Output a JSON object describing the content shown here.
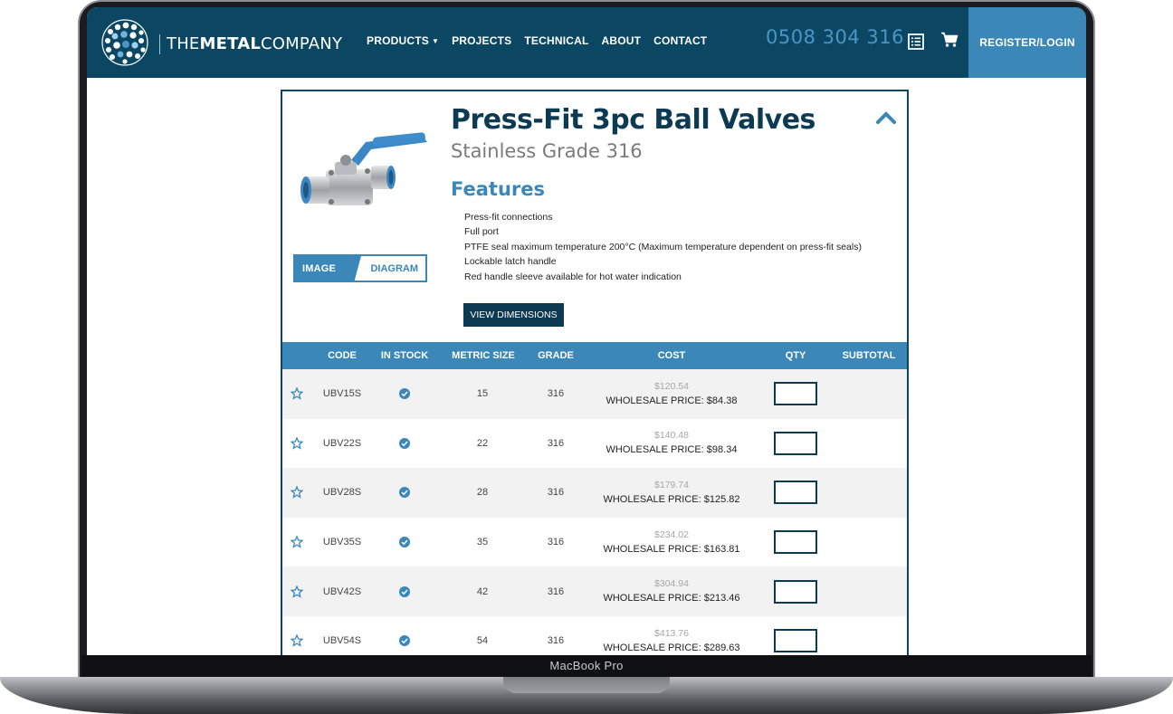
{
  "device_label": "MacBook Pro",
  "header": {
    "logo_text_light_1": "THE",
    "logo_text_bold": "METAL",
    "logo_text_light_2": "COMPANY",
    "nav": [
      {
        "label": "PRODUCTS",
        "has_dropdown": true
      },
      {
        "label": "PROJECTS"
      },
      {
        "label": "TECHNICAL"
      },
      {
        "label": "ABOUT"
      },
      {
        "label": "CONTACT"
      }
    ],
    "phone": "0508 304 316",
    "register_label": "REGISTER/LOGIN",
    "list_icon": "list-icon",
    "cart_icon": "cart-icon"
  },
  "product": {
    "title": "Press-Fit 3pc Ball Valves",
    "subtitle": "Stainless Grade 316",
    "toggle": {
      "image_label": "IMAGE",
      "diagram_label": "DIAGRAM",
      "selected": "IMAGE"
    },
    "features_heading": "Features",
    "features": [
      "Press-fit connections",
      "Full port",
      "PTFE seal maximum temperature 200°C (Maximum temperature dependent on press-fit seals)",
      "Lockable latch handle",
      "Red handle sleeve available for hot water indication"
    ],
    "view_dimensions_label": "VIEW DIMENSIONS"
  },
  "table": {
    "headers": {
      "code": "CODE",
      "in_stock": "IN STOCK",
      "metric_size": "METRIC SIZE",
      "grade": "GRADE",
      "cost": "COST",
      "qty": "QTY",
      "subtotal": "SUBTOTAL"
    },
    "rows": [
      {
        "code": "UBV15S",
        "in_stock": true,
        "size": "15",
        "grade": "316",
        "rrp": "$120.54",
        "wholesale_label": "WHOLESALE PRICE: ",
        "wholesale": "$84.38"
      },
      {
        "code": "UBV22S",
        "in_stock": true,
        "size": "22",
        "grade": "316",
        "rrp": "$140.48",
        "wholesale_label": "WHOLESALE PRICE: ",
        "wholesale": "$98.34"
      },
      {
        "code": "UBV28S",
        "in_stock": true,
        "size": "28",
        "grade": "316",
        "rrp": "$179.74",
        "wholesale_label": "WHOLESALE PRICE: ",
        "wholesale": "$125.82"
      },
      {
        "code": "UBV35S",
        "in_stock": true,
        "size": "35",
        "grade": "316",
        "rrp": "$234.02",
        "wholesale_label": "WHOLESALE PRICE: ",
        "wholesale": "$163.81"
      },
      {
        "code": "UBV42S",
        "in_stock": true,
        "size": "42",
        "grade": "316",
        "rrp": "$304.94",
        "wholesale_label": "WHOLESALE PRICE: ",
        "wholesale": "$213.46"
      },
      {
        "code": "UBV54S",
        "in_stock": true,
        "size": "54",
        "grade": "316",
        "rrp": "$413.76",
        "wholesale_label": "WHOLESALE PRICE: ",
        "wholesale": "$289.63"
      }
    ]
  },
  "colors": {
    "header_bg": "#0b4763",
    "accent_blue": "#3b87b8",
    "title_dark": "#0b3a52",
    "row_alt": "#f2f2f2"
  }
}
